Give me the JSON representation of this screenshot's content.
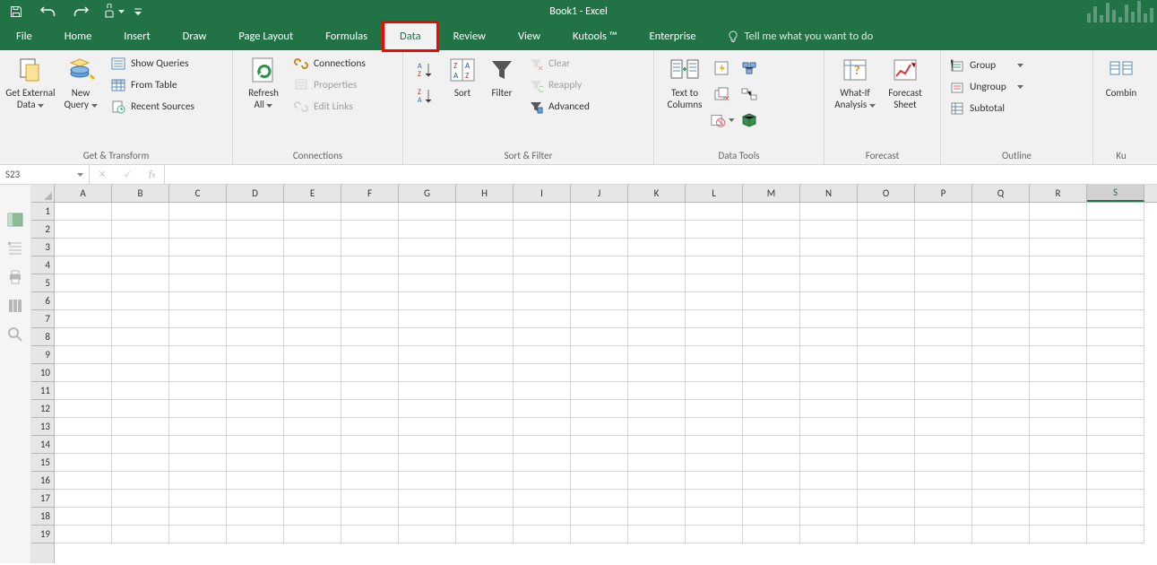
{
  "title": "Book1 - Excel",
  "qat": {
    "save": "Save",
    "undo": "Undo",
    "redo": "Redo",
    "touch": "Touch/Mouse Mode",
    "customize": "Customize Quick Access Toolbar"
  },
  "tabs": [
    "File",
    "Home",
    "Insert",
    "Draw",
    "Page Layout",
    "Formulas",
    "Data",
    "Review",
    "View",
    "Kutools ™",
    "Enterprise"
  ],
  "active_tab": "Data",
  "highlight_tab": "Data",
  "tellme_placeholder": "Tell me what you want to do",
  "ribbon": {
    "groups": [
      {
        "name": "Get & Transform",
        "items": {
          "get_external": "Get External\nData",
          "new_query": "New\nQuery",
          "show_queries": "Show Queries",
          "from_table": "From Table",
          "recent_sources": "Recent Sources"
        }
      },
      {
        "name": "Connections",
        "items": {
          "refresh_all": "Refresh\nAll",
          "connections": "Connections",
          "properties": "Properties",
          "edit_links": "Edit Links"
        }
      },
      {
        "name": "Sort & Filter",
        "items": {
          "sort": "Sort",
          "filter": "Filter",
          "clear": "Clear",
          "reapply": "Reapply",
          "advanced": "Advanced"
        }
      },
      {
        "name": "Data Tools",
        "items": {
          "text_to_columns": "Text to\nColumns"
        }
      },
      {
        "name": "Forecast",
        "items": {
          "whatif": "What-If\nAnalysis",
          "forecast_sheet": "Forecast\nSheet"
        }
      },
      {
        "name": "Outline",
        "items": {
          "group": "Group",
          "ungroup": "Ungroup",
          "subtotal": "Subtotal"
        }
      },
      {
        "name": "Ku",
        "items": {
          "combine": "Combin"
        }
      }
    ]
  },
  "namebox": "S23",
  "formula": "",
  "columns": [
    "A",
    "B",
    "C",
    "D",
    "E",
    "F",
    "G",
    "H",
    "I",
    "J",
    "K",
    "L",
    "M",
    "N",
    "O",
    "P",
    "Q",
    "R",
    "S"
  ],
  "selected_column": "S",
  "rows": [
    1,
    2,
    3,
    4,
    5,
    6,
    7,
    8,
    9,
    10,
    11,
    12,
    13,
    14,
    15,
    16,
    17,
    18,
    19
  ]
}
